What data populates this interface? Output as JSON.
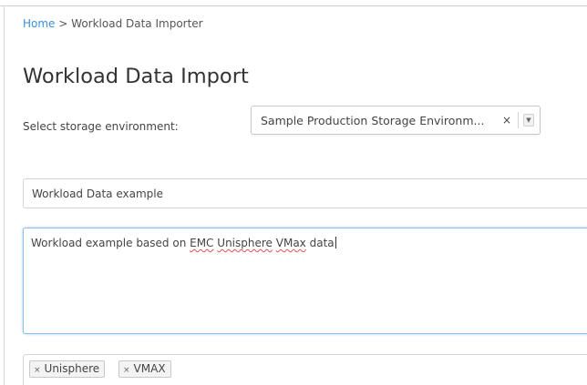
{
  "breadcrumb": {
    "home": "Home",
    "separator": ">",
    "current": "Workload Data Importer"
  },
  "page_title": "Workload Data Import",
  "environment": {
    "label": "Select storage environment:",
    "selected": "Sample Production Storage Environm...",
    "clear_symbol": "×",
    "dropdown_icon": "chevron-down-icon"
  },
  "name_field": {
    "value": "Workload Data example"
  },
  "description": {
    "text_before": "Workload example based on ",
    "word_emc": "EMC",
    "word_unisphere": "Unisphere",
    "word_vmax": "VMax",
    "text_after": " data"
  },
  "tags": [
    {
      "label": "Unisphere",
      "remove_symbol": "×"
    },
    {
      "label": "VMAX",
      "remove_symbol": "×"
    }
  ],
  "colors": {
    "link": "#3b8fd6",
    "focus_border": "#8fbde6",
    "spellcheck": "#e05050"
  }
}
